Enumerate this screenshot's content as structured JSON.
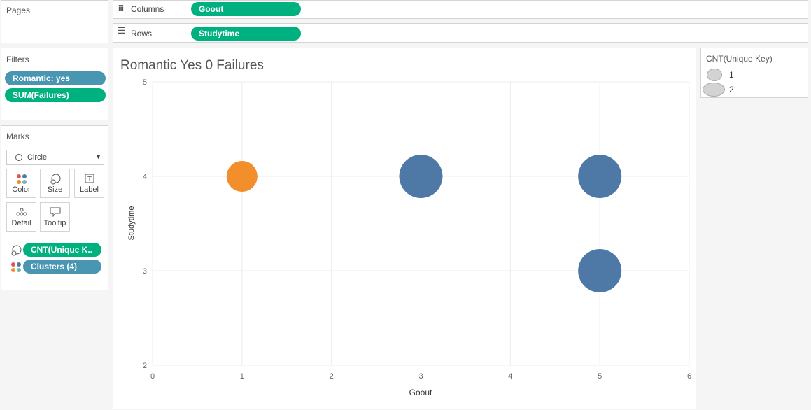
{
  "pages": {
    "title": "Pages"
  },
  "columns_shelf": {
    "label": "Columns",
    "pill": "Goout"
  },
  "rows_shelf": {
    "label": "Rows",
    "pill": "Studytime"
  },
  "filters": {
    "title": "Filters",
    "items": [
      "Romantic: yes",
      "SUM(Failures)"
    ]
  },
  "marks": {
    "title": "Marks",
    "type": "Circle",
    "buttons": {
      "color": "Color",
      "size": "Size",
      "label": "Label",
      "detail": "Detail",
      "tooltip": "Tooltip"
    },
    "fields": [
      "CNT(Unique K..",
      "Clusters (4)"
    ]
  },
  "legend": {
    "title": "CNT(Unique Key)",
    "items": [
      "1",
      "2"
    ]
  },
  "colors": {
    "green_pill": "#00b180",
    "blue_pill": "#4996b2",
    "orange": "#f28e2b",
    "blue": "#4e79a7"
  },
  "chart_data": {
    "type": "scatter",
    "title": "Romantic Yes 0 Failures",
    "xlabel": "Goout",
    "ylabel": "Studytime",
    "xlim": [
      0,
      6
    ],
    "ylim": [
      2,
      5
    ],
    "xticks": [
      0,
      1,
      2,
      3,
      4,
      5,
      6
    ],
    "yticks": [
      2,
      3,
      4,
      5
    ],
    "grid": true,
    "points": [
      {
        "x": 1,
        "y": 4,
        "count": 1,
        "cluster": "orange"
      },
      {
        "x": 3,
        "y": 4,
        "count": 2,
        "cluster": "blue"
      },
      {
        "x": 5,
        "y": 4,
        "count": 2,
        "cluster": "blue"
      },
      {
        "x": 5,
        "y": 3,
        "count": 2,
        "cluster": "blue"
      }
    ]
  }
}
